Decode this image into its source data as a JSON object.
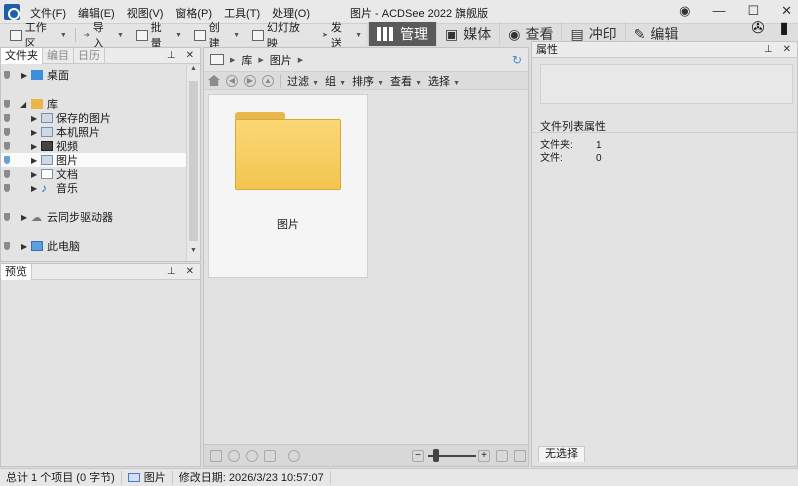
{
  "window": {
    "title": "图片 - ACDSee 2022 旗舰版",
    "menu": [
      "文件(F)",
      "编辑(E)",
      "视图(V)",
      "窗格(P)",
      "工具(T)",
      "处理(O)"
    ]
  },
  "toolbar": {
    "workspace": "工作区",
    "import": "导入",
    "batch": "批量",
    "create": "创建",
    "slideshow": "幻灯放映",
    "send": "发送"
  },
  "modes": [
    "管理",
    "媒体",
    "查看",
    "冲印",
    "编辑"
  ],
  "folder_panel": {
    "tabs": [
      "文件夹",
      "编目",
      "日历"
    ],
    "items": [
      {
        "label": "桌面",
        "level": 0
      },
      {
        "label": "库",
        "level": 0,
        "expanded": true
      },
      {
        "label": "保存的图片",
        "level": 1
      },
      {
        "label": "本机照片",
        "level": 1
      },
      {
        "label": "视频",
        "level": 1
      },
      {
        "label": "图片",
        "level": 1,
        "selected": true
      },
      {
        "label": "文档",
        "level": 1
      },
      {
        "label": "音乐",
        "level": 1
      },
      {
        "label": "云同步驱动器",
        "level": 0
      },
      {
        "label": "此电脑",
        "level": 0
      }
    ]
  },
  "preview_panel": {
    "title": "预览"
  },
  "browser": {
    "path": [
      "库",
      "图片"
    ],
    "filters": [
      "过滤",
      "组",
      "排序",
      "查看",
      "选择"
    ],
    "items": [
      {
        "label": "图片",
        "type": "folder"
      }
    ]
  },
  "properties": {
    "title": "属性",
    "section": "文件列表属性",
    "rows": [
      {
        "key": "文件夹:",
        "value": "1"
      },
      {
        "key": "文件:",
        "value": "0"
      }
    ],
    "tab": "无选择"
  },
  "status": {
    "total": "总计 1 个项目 (0 字节)",
    "folder": "图片",
    "modified": "修改日期: 2026/3/23 10:57:07"
  }
}
